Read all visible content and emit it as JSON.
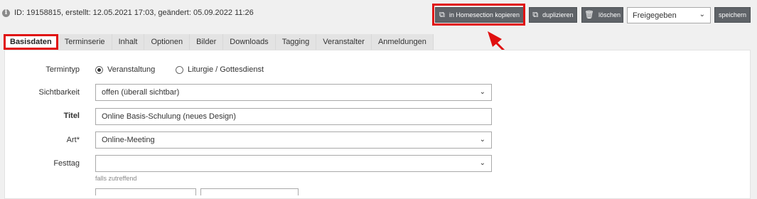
{
  "info": {
    "text": "ID: 19158815, erstellt: 12.05.2021 17:03, geändert: 05.09.2022 11:26",
    "icon": "info-icon"
  },
  "toolbar": {
    "copy_label": "in Homesection kopieren",
    "duplicate_label": "duplizieren",
    "delete_label": "löschen",
    "status_value": "Freigegeben",
    "save_label": "speichern"
  },
  "tabs": [
    {
      "label": "Basisdaten"
    },
    {
      "label": "Terminserie"
    },
    {
      "label": "Inhalt"
    },
    {
      "label": "Optionen"
    },
    {
      "label": "Bilder"
    },
    {
      "label": "Downloads"
    },
    {
      "label": "Tagging"
    },
    {
      "label": "Veranstalter"
    },
    {
      "label": "Anmeldungen"
    }
  ],
  "form": {
    "termintyp": {
      "label": "Termintyp",
      "options": [
        "Veranstaltung",
        "Liturgie / Gottesdienst"
      ],
      "selected": "Veranstaltung"
    },
    "sichtbarkeit": {
      "label": "Sichtbarkeit",
      "value": "offen (überall sichtbar)"
    },
    "titel": {
      "label": "Titel",
      "value": "Online Basis-Schulung (neues Design)"
    },
    "art": {
      "label": "Art*",
      "value": "Online-Meeting"
    },
    "festtag": {
      "label": "Festtag",
      "value": "",
      "hint": "falls zutreffend"
    }
  },
  "colors": {
    "highlight": "#e01010",
    "button": "#5f6368",
    "arrow": "#e01010"
  }
}
